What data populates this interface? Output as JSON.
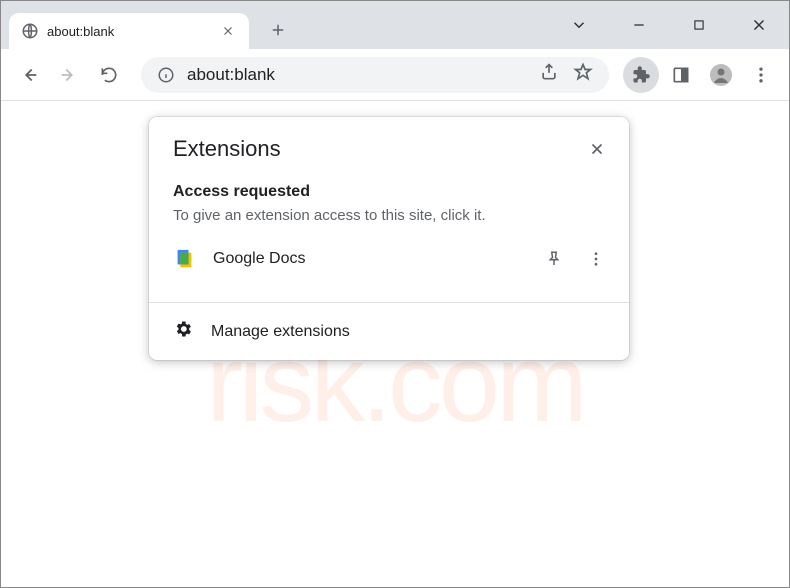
{
  "tab": {
    "title": "about:blank"
  },
  "omnibox": {
    "url": "about:blank"
  },
  "popup": {
    "title": "Extensions",
    "section_heading": "Access requested",
    "section_desc": "To give an extension access to this site, click it.",
    "extensions": [
      {
        "name": "Google Docs"
      }
    ],
    "manage_label": "Manage extensions"
  }
}
